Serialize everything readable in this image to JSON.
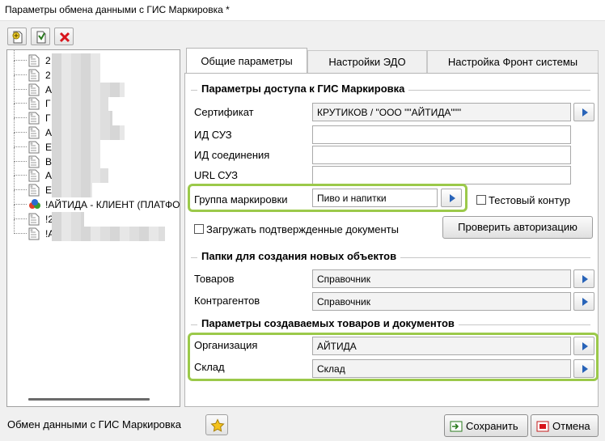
{
  "window": {
    "title": "Параметры обмена данными с ГИС Маркировка *"
  },
  "toolbar": {
    "icons": [
      "add-doc-icon",
      "copy-doc-icon",
      "delete-icon"
    ]
  },
  "tree": {
    "items": [
      {
        "label": "2",
        "icon": "doc-icon"
      },
      {
        "label": "2",
        "icon": "doc-icon"
      },
      {
        "label": "А",
        "icon": "doc-icon"
      },
      {
        "label": "Г",
        "icon": "doc-icon"
      },
      {
        "label": "Г",
        "icon": "doc-icon"
      },
      {
        "label": "А",
        "icon": "doc-icon"
      },
      {
        "label": "Е",
        "icon": "doc-icon"
      },
      {
        "label": "В",
        "icon": "doc-icon"
      },
      {
        "label": "А",
        "icon": "doc-icon"
      },
      {
        "label": "Е",
        "icon": "doc-icon"
      },
      {
        "label": "!АЙТИДА - КЛИЕНТ (ПЛАТФОРМА",
        "icon": "org-icon"
      },
      {
        "label": "!2",
        "icon": "doc-icon"
      },
      {
        "label": "!А",
        "icon": "doc-icon"
      }
    ]
  },
  "tabs": [
    {
      "label": "Общие параметры",
      "active": true
    },
    {
      "label": "Настройки ЭДО",
      "active": false
    },
    {
      "label": "Настройка Фронт системы",
      "active": false
    }
  ],
  "access": {
    "section_title": "Параметры доступа к ГИС Маркировка",
    "certificate_label": "Сертификат",
    "certificate_value": "КРУТИКОВ / \"ООО \"\"АЙТИДА\"\"\"",
    "suz_id_label": "ИД СУЗ",
    "suz_id_value": "",
    "connection_id_label": "ИД соединения",
    "connection_id_value": "",
    "suz_url_label": "URL СУЗ",
    "suz_url_value": "",
    "marking_group_label": "Группа маркировки",
    "marking_group_value": "Пиво и напитки",
    "test_circuit_label": "Тестовый контур",
    "load_confirmed_label": "Загружать подтвержденные документы",
    "check_auth_label": "Проверить авторизацию"
  },
  "folders": {
    "section_title": "Папки для создания новых объектов",
    "goods_label": "Товаров",
    "goods_value": "Справочник",
    "contractors_label": "Контрагентов",
    "contractors_value": "Справочник"
  },
  "params": {
    "section_title": "Параметры создаваемых товаров и документов",
    "org_label": "Организация",
    "org_value": "АЙТИДА",
    "warehouse_label": "Склад",
    "warehouse_value": "Склад"
  },
  "footer": {
    "label": "Обмен данными с ГИС Маркировка",
    "save_label": "Сохранить",
    "cancel_label": "Отмена"
  },
  "colors": {
    "highlight": "#9bc94a",
    "accent_blue": "#2863b8",
    "delete_red": "#d8141b"
  }
}
